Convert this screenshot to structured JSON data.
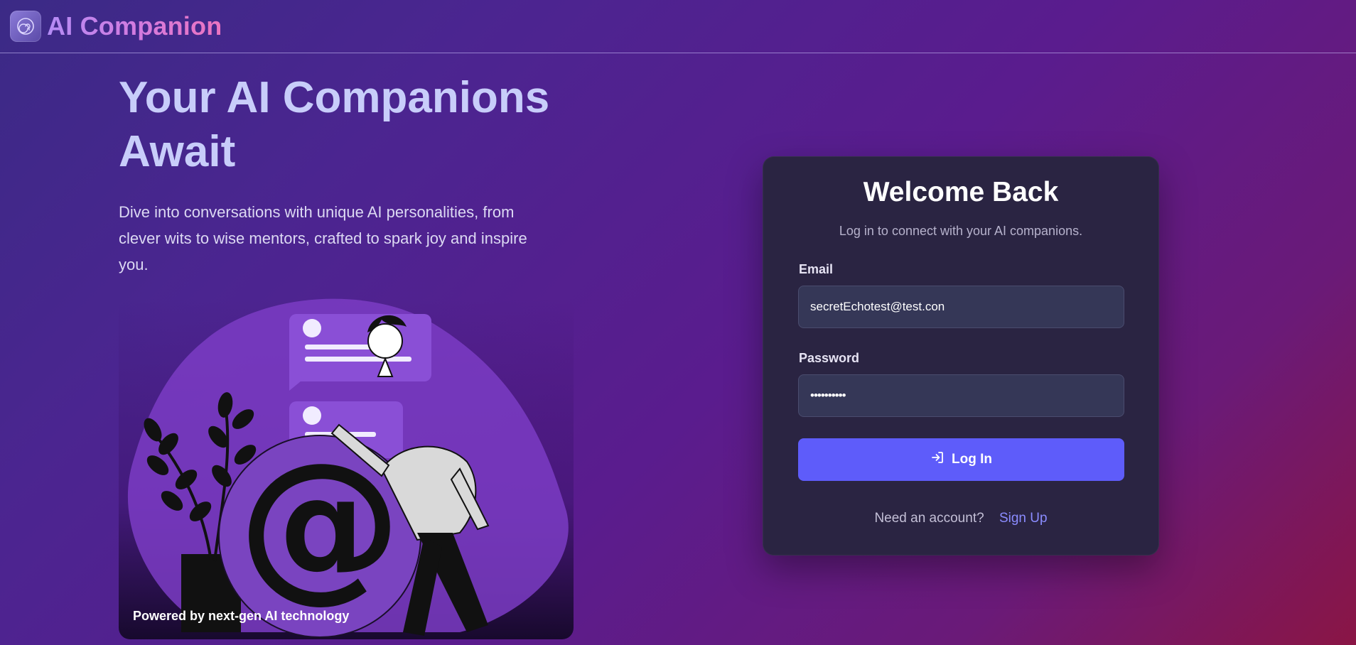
{
  "header": {
    "logo_icon": "spiral-logo-icon",
    "app_name": "AI Companion"
  },
  "hero": {
    "title": "Your AI Companions Await",
    "subtitle": "Dive into conversations with unique AI personalities, from clever wits to wise mentors, crafted to spark joy and inspire you.",
    "illustration_caption": "Powered by next-gen AI technology"
  },
  "login": {
    "title": "Welcome Back",
    "subtitle": "Log in to connect with your AI companions.",
    "email_label": "Email",
    "email_value": "secretEchotest@test.con",
    "password_label": "Password",
    "password_value": "••••••••••",
    "login_button_label": "Log In",
    "login_button_icon": "log-in-icon",
    "need_account_text": "Need an account?",
    "signup_link": "Sign Up"
  },
  "colors": {
    "accent": "#5e5cfa",
    "card_bg": "#2a2442",
    "link": "#8b8cff"
  }
}
